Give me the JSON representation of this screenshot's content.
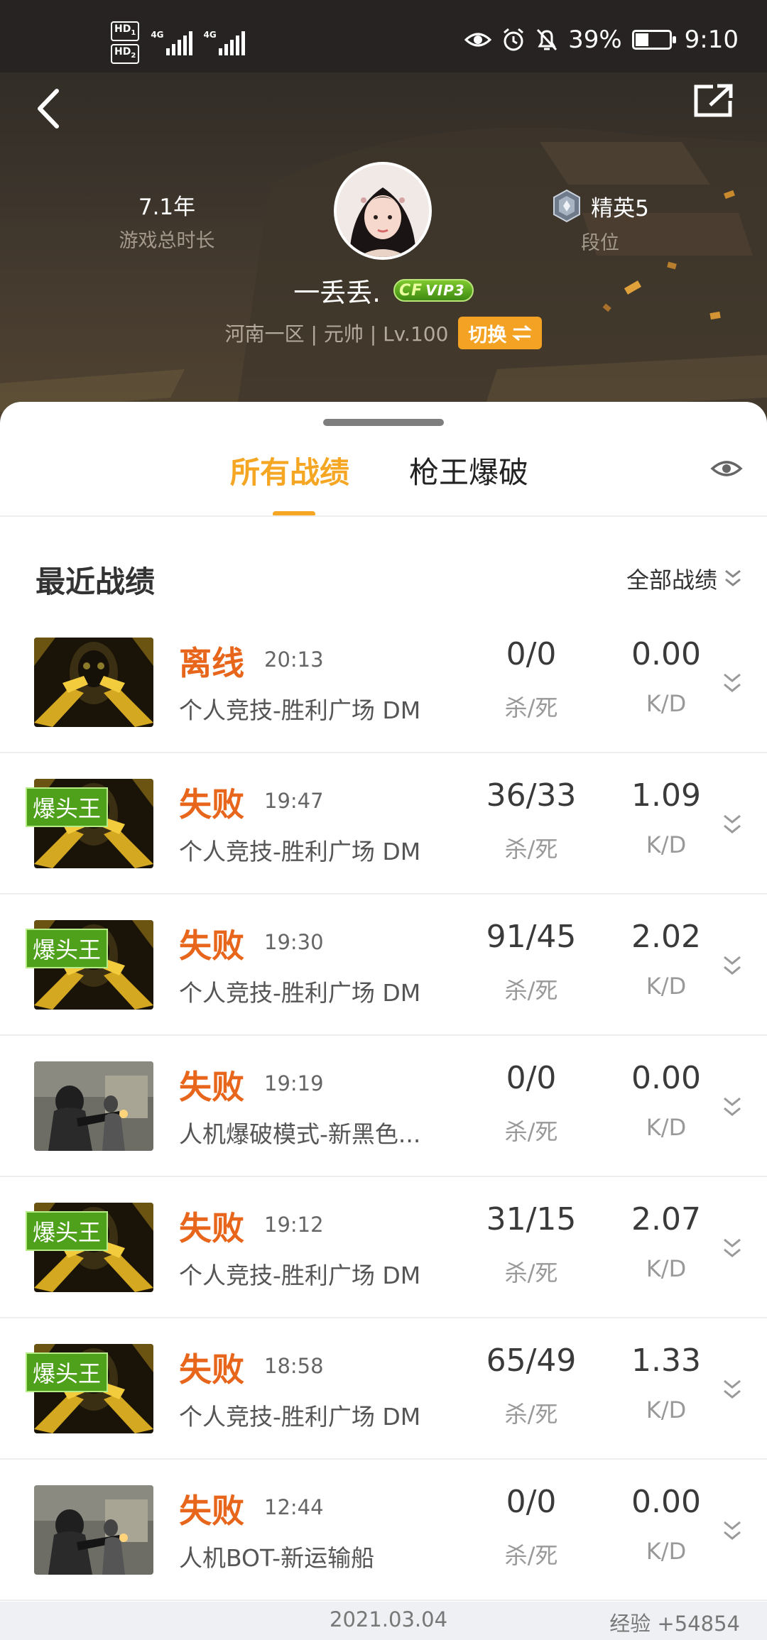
{
  "status_bar": {
    "hd1": "HD",
    "hd2": "HD",
    "network1": "4G",
    "network2": "4G",
    "battery": "39%",
    "time": "9:10",
    "icons": [
      "eye-icon",
      "alarm-icon",
      "bell-off-icon",
      "battery-icon"
    ]
  },
  "header": {
    "back_icon": "chevron-left-icon",
    "share_icon": "share-icon",
    "play_time_value": "7.1年",
    "play_time_label": "游戏总时长",
    "rank_value": "精英5",
    "rank_label": "段位",
    "username": "一丢丢.",
    "vip_label": "VIP3",
    "vip_prefix": "CF",
    "server_info": "河南一区 | 元帅 | Lv.100",
    "switch_label": "切换"
  },
  "tabs": [
    {
      "label": "所有战绩",
      "active": true
    },
    {
      "label": "枪王爆破",
      "active": false
    }
  ],
  "section": {
    "title": "最近战绩",
    "filter_label": "全部战绩"
  },
  "records": [
    {
      "result": "离线",
      "time": "20:13",
      "mode": "个人竞技-胜利广场 DM",
      "kills_deaths": "0/0",
      "kd": "0.00",
      "kills_label": "杀/死",
      "kd_label": "K/D",
      "badge": "",
      "thumb": "gold-pistols"
    },
    {
      "result": "失败",
      "time": "19:47",
      "mode": "个人竞技-胜利广场 DM",
      "kills_deaths": "36/33",
      "kd": "1.09",
      "kills_label": "杀/死",
      "kd_label": "K/D",
      "badge": "爆头王",
      "thumb": "gold-pistols"
    },
    {
      "result": "失败",
      "time": "19:30",
      "mode": "个人竞技-胜利广场 DM",
      "kills_deaths": "91/45",
      "kd": "2.02",
      "kills_label": "杀/死",
      "kd_label": "K/D",
      "badge": "爆头王",
      "thumb": "gold-pistols"
    },
    {
      "result": "失败",
      "time": "19:19",
      "mode": "人机爆破模式-新黑色...",
      "kills_deaths": "0/0",
      "kd": "0.00",
      "kills_label": "杀/死",
      "kd_label": "K/D",
      "badge": "",
      "thumb": "soldiers"
    },
    {
      "result": "失败",
      "time": "19:12",
      "mode": "个人竞技-胜利广场 DM",
      "kills_deaths": "31/15",
      "kd": "2.07",
      "kills_label": "杀/死",
      "kd_label": "K/D",
      "badge": "爆头王",
      "thumb": "gold-pistols"
    },
    {
      "result": "失败",
      "time": "18:58",
      "mode": "个人竞技-胜利广场 DM",
      "kills_deaths": "65/49",
      "kd": "1.33",
      "kills_label": "杀/死",
      "kd_label": "K/D",
      "badge": "爆头王",
      "thumb": "gold-pistols"
    },
    {
      "result": "失败",
      "time": "12:44",
      "mode": "人机BOT-新运输船",
      "kills_deaths": "0/0",
      "kd": "0.00",
      "kills_label": "杀/死",
      "kd_label": "K/D",
      "badge": "",
      "thumb": "soldiers"
    }
  ],
  "footer": {
    "date": "2021.03.04",
    "exp": "经验 +54854"
  },
  "colors": {
    "accent": "#f5a623",
    "result": "#e8661b",
    "badge": "#4fa11c"
  }
}
